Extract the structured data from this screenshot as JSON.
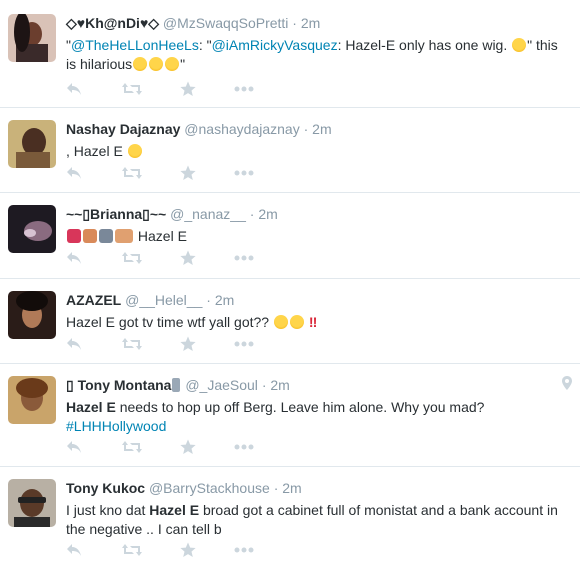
{
  "tweets": [
    {
      "name": "◇♥Kh@nDi♥◇",
      "handle": "@MzSwaqqSoPretti",
      "sep": "·",
      "time": "2m",
      "parts": [
        {
          "t": "\"",
          "c": "text"
        },
        {
          "t": "@TheHeLLonHeeLs",
          "c": "mention"
        },
        {
          "t": ": \"",
          "c": "text"
        },
        {
          "t": "@iAmRickyVasquez",
          "c": "mention"
        },
        {
          "t": ": Hazel-E only has one wig. ",
          "c": "text"
        },
        {
          "t": "\" this is hilarious",
          "c": "text"
        }
      ],
      "emoji_mid": "smirk",
      "emoji_end_count": 3,
      "end": "\""
    },
    {
      "name": "Nashay Dajaznay",
      "handle": "@nashaydajaznay",
      "sep": "·",
      "time": "2m",
      "parts": [
        {
          "t": ", Hazel E ",
          "c": "text"
        }
      ],
      "emoji_end_count": 1
    },
    {
      "name": "~~▯Brianna▯~~",
      "handle": "@_nanaz__",
      "sep": "·",
      "time": "2m",
      "parts": [
        {
          "t": "Hazel E",
          "c": "text"
        }
      ],
      "emoji_lead_count": 4
    },
    {
      "name": "AZAZEL",
      "handle": "@__Helel__",
      "sep": "·",
      "time": "2m",
      "parts": [
        {
          "t": "Hazel E got tv time wtf yall got?? ",
          "c": "text"
        }
      ],
      "emoji_end_count": 2,
      "bang": "‼"
    },
    {
      "name": "▯ Tony Montana",
      "handle": "@_JaeSoul",
      "sep": "·",
      "time": "2m",
      "parts": [
        {
          "t": "Hazel E",
          "c": "hl"
        },
        {
          "t": " needs to hop up off Berg. Leave him alone. Why you mad? ",
          "c": "text"
        },
        {
          "t": "#LHHHollywood",
          "c": "hashtag"
        }
      ],
      "has_geo": true
    },
    {
      "name": "Tony Kukoc",
      "handle": "@BarryStackhouse",
      "sep": "·",
      "time": "2m",
      "parts": [
        {
          "t": "I just kno dat ",
          "c": "text"
        },
        {
          "t": "Hazel E",
          "c": "hl"
        },
        {
          "t": " broad got a cabinet full of monistat and a bank account in the negative .. I can tell b",
          "c": "text"
        }
      ]
    }
  ],
  "icons": [
    "reply-icon",
    "retweet-icon",
    "favorite-icon",
    "more-icon"
  ],
  "colors": {
    "link": "#0084b4",
    "muted": "#8899a6",
    "text": "#292f33",
    "icon": "#ccd6dd",
    "border": "#e1e8ed"
  }
}
